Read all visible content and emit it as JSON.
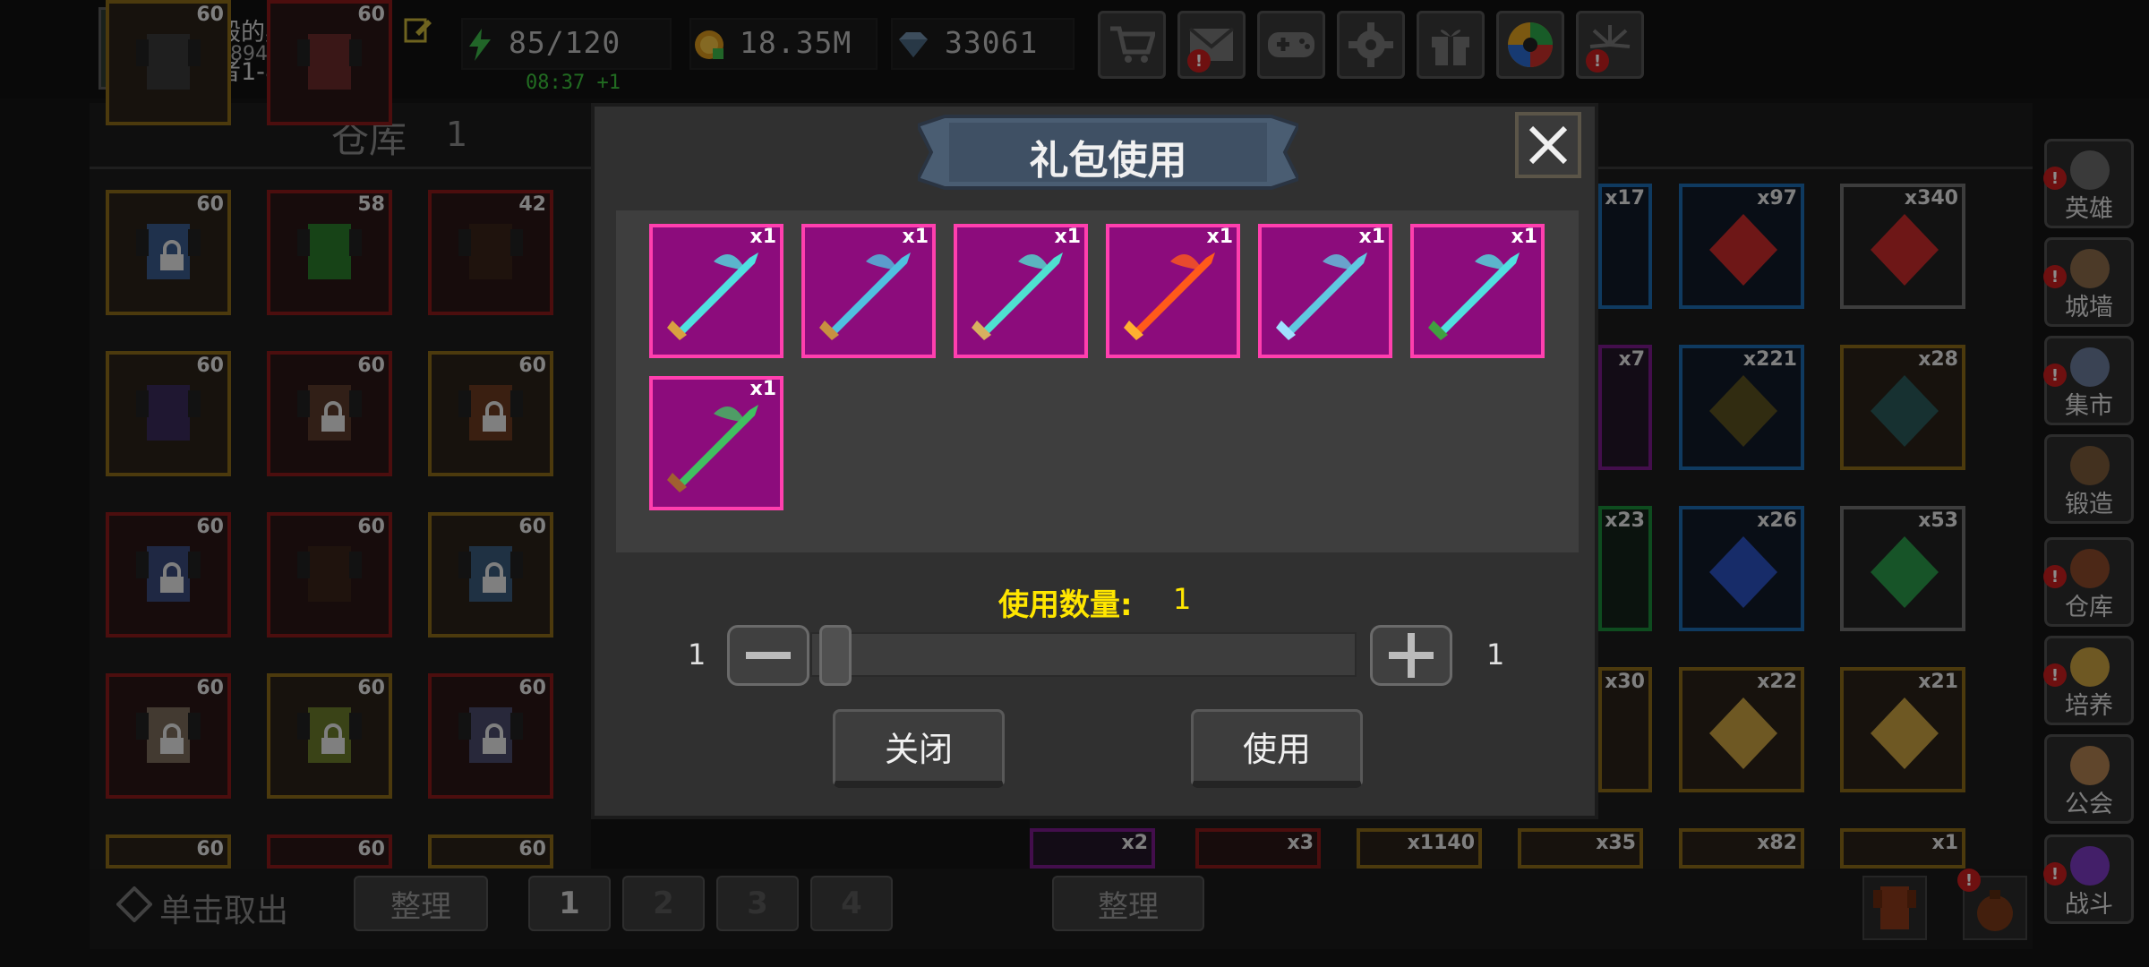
{
  "player": {
    "name": "神殿的奥丽芙",
    "id": "4758949",
    "rank": "勇者1-8阶"
  },
  "resources": {
    "energy": "85/120",
    "gold": "18.35M",
    "gems": "33061",
    "energy_timer": "08:37 +1"
  },
  "top_icons": [
    "cart-icon",
    "mail-icon",
    "gamepad-icon",
    "gear-icon",
    "gift-icon",
    "camera-aperture-icon",
    "firework-icon"
  ],
  "warehouse": {
    "title": "仓库",
    "tab_number": "1"
  },
  "left_slots": [
    {
      "lvl": "60",
      "color": "gold"
    },
    {
      "lvl": "58",
      "color": "red"
    },
    {
      "lvl": "42",
      "color": "red"
    },
    {
      "lvl": "60",
      "color": "gold"
    },
    {
      "lvl": "60",
      "color": "red"
    },
    {
      "lvl": "60",
      "color": "gold"
    },
    {
      "lvl": "60",
      "color": "red"
    },
    {
      "lvl": "60",
      "color": "red"
    },
    {
      "lvl": "60",
      "color": "gold"
    },
    {
      "lvl": "60",
      "color": "red"
    },
    {
      "lvl": "60",
      "color": "gold"
    },
    {
      "lvl": "60",
      "color": "red"
    },
    {
      "lvl": "60",
      "color": "gold"
    },
    {
      "lvl": "60",
      "color": "red"
    },
    {
      "lvl": "60",
      "color": "gold"
    },
    {
      "lvl": "60",
      "color": "gold"
    },
    {
      "lvl": "60",
      "color": "red"
    }
  ],
  "right_slots": [
    {
      "count": "x17"
    },
    {
      "count": "x97"
    },
    {
      "count": "x340"
    },
    {
      "count": "x7"
    },
    {
      "count": "x221"
    },
    {
      "count": "x28"
    },
    {
      "count": "x23"
    },
    {
      "count": "x26"
    },
    {
      "count": "x53"
    },
    {
      "count": "x30"
    },
    {
      "count": "x22"
    },
    {
      "count": "x21"
    },
    {
      "count": "x2"
    },
    {
      "count": "x3"
    },
    {
      "count": "x1140"
    },
    {
      "count": "x35"
    },
    {
      "count": "x82"
    },
    {
      "count": "x1"
    }
  ],
  "bottom": {
    "take_out": "单击取出",
    "sort_left": "整理",
    "pages": [
      "1",
      "2",
      "3",
      "4"
    ],
    "sort_right": "整理"
  },
  "sidebar": [
    {
      "label": "英雄",
      "icon": "helmet-icon"
    },
    {
      "label": "城墙",
      "icon": "wall-icon"
    },
    {
      "label": "集市",
      "icon": "market-icon"
    },
    {
      "label": "锻造",
      "icon": "anvil-icon"
    },
    {
      "label": "仓库",
      "icon": "chest-icon"
    },
    {
      "label": "培养",
      "icon": "trophy-icon"
    },
    {
      "label": "公会",
      "icon": "guild-icon"
    },
    {
      "label": "战斗",
      "icon": "portal-icon"
    }
  ],
  "modal": {
    "title": "礼包使用",
    "items": [
      {
        "name": "axe",
        "count": "x1"
      },
      {
        "name": "sword",
        "count": "x1"
      },
      {
        "name": "scimitar",
        "count": "x1"
      },
      {
        "name": "fire-bow",
        "count": "x1"
      },
      {
        "name": "hammer",
        "count": "x1"
      },
      {
        "name": "blade",
        "count": "x1"
      },
      {
        "name": "green-bow",
        "count": "x1"
      }
    ],
    "qty_label": "使用数量:",
    "qty_value": "1",
    "slider_min": "1",
    "slider_max": "1",
    "slider_value": 1,
    "close_label": "关闭",
    "use_label": "使用"
  },
  "colors": {
    "gift_border": "#ff3fae",
    "gift_bg": "#8c0c7c",
    "qty_text": "#ffe600",
    "timer": "#3dc43d",
    "badge": "#c81e1e"
  }
}
